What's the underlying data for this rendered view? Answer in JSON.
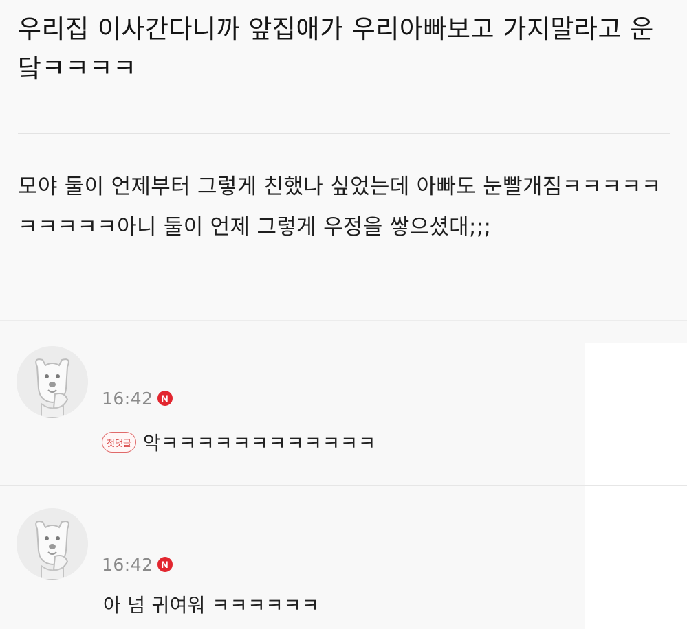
{
  "post": {
    "title": "우리집 이사간다니까 앞집애가 우리아빠보고 가지말라고 운닼ㅋㅋㅋㅋ",
    "body": "모야 둘이 언제부터 그렇게 친했나 싶었는데 아빠도 눈빨개짐ㅋㅋㅋㅋㅋㅋㅋㅋㅋㅋ아니 둘이 언제 그렇게 우정을 쌓으셨대;;;"
  },
  "comments": [
    {
      "avatar_icon": "dog-character-icon",
      "time": "16:42",
      "new_badge": "N",
      "first_comment_badge": "첫댓글",
      "text": "악ㅋㅋㅋㅋㅋㅋㅋㅋㅋㅋㅋㅋ"
    },
    {
      "avatar_icon": "dog-character-icon",
      "time": "16:42",
      "new_badge": "N",
      "text": "아 넘 귀여워 ㅋㅋㅋㅋㅋㅋ"
    }
  ],
  "colors": {
    "background": "#f8f8f8",
    "new_badge": "#e2262f",
    "first_comment_badge": "#d94848",
    "timestamp": "#8a8a8a"
  }
}
